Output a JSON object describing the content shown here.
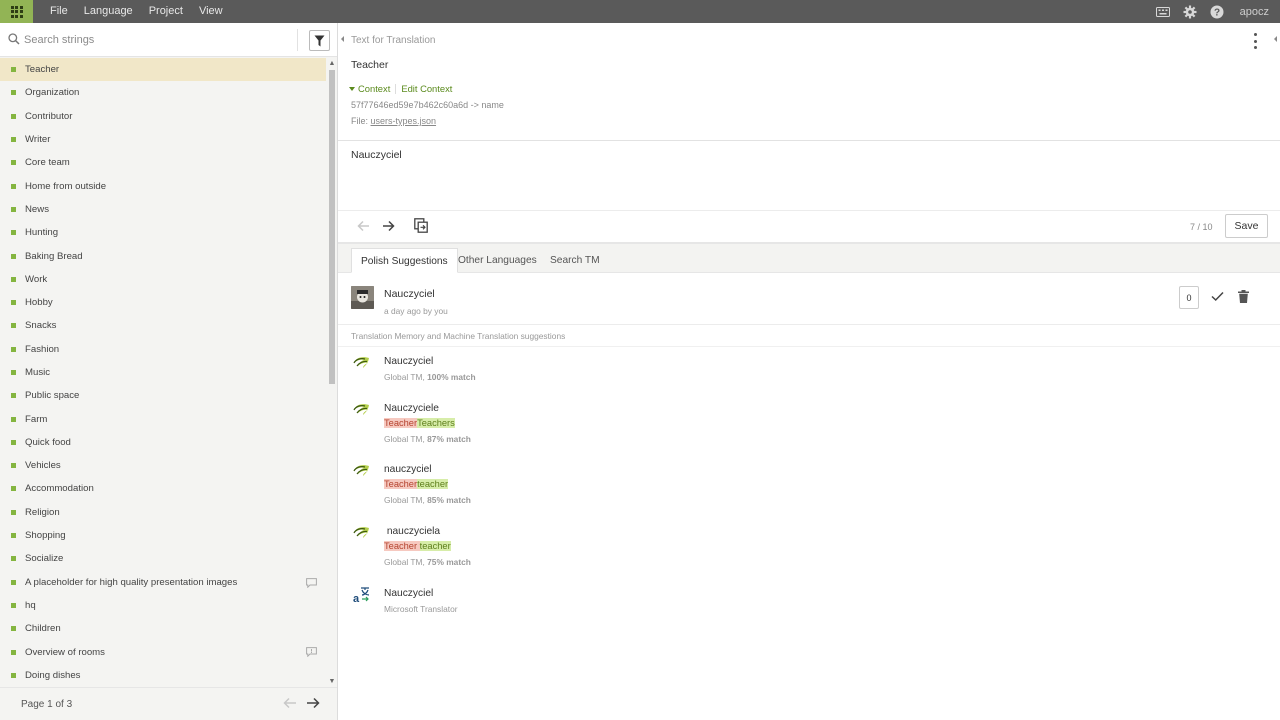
{
  "menubar": {
    "items": [
      "File",
      "Language",
      "Project",
      "View"
    ],
    "username": "apocz",
    "icons": [
      "keyboard-icon",
      "gear-icon",
      "help-icon"
    ]
  },
  "search": {
    "placeholder": "Search strings"
  },
  "strings": [
    {
      "label": "Teacher",
      "selected": true
    },
    {
      "label": "Organization"
    },
    {
      "label": "Contributor"
    },
    {
      "label": "Writer"
    },
    {
      "label": "Core team"
    },
    {
      "label": "Home from outside"
    },
    {
      "label": "News"
    },
    {
      "label": "Hunting"
    },
    {
      "label": "Baking Bread"
    },
    {
      "label": "Work"
    },
    {
      "label": "Hobby"
    },
    {
      "label": "Snacks"
    },
    {
      "label": "Fashion"
    },
    {
      "label": "Music"
    },
    {
      "label": "Public space"
    },
    {
      "label": "Farm"
    },
    {
      "label": "Quick food"
    },
    {
      "label": "Vehicles"
    },
    {
      "label": "Accommodation"
    },
    {
      "label": "Religion"
    },
    {
      "label": "Shopping"
    },
    {
      "label": "Socialize"
    },
    {
      "label": "A placeholder for high quality presentation images",
      "icon": "comment-icon"
    },
    {
      "label": "hq"
    },
    {
      "label": "Children"
    },
    {
      "label": "Overview of rooms",
      "icon": "comment-alert-icon"
    },
    {
      "label": "Doing dishes"
    }
  ],
  "pagination": {
    "label": "Page 1 of 3"
  },
  "editor": {
    "section_label": "Text for Translation",
    "source_text": "Teacher",
    "context_label": "Context",
    "edit_context_label": "Edit Context",
    "context_key": "57f77646ed59e7b462c60a6d -> name",
    "file_prefix": "File: ",
    "file_name": "users-types.json",
    "translation": "Nauczyciel",
    "counter": "7 / 10",
    "save_label": "Save"
  },
  "tabs": [
    {
      "label": "Polish Suggestions",
      "active": true
    },
    {
      "label": "Other Languages"
    },
    {
      "label": "Search TM"
    }
  ],
  "my_suggestion": {
    "text": "Nauczyciel",
    "meta": "a day ago by you",
    "votes": "0"
  },
  "tm_heading": "Translation Memory and Machine Translation suggestions",
  "tm_suggestions": [
    {
      "text": "Nauczyciel",
      "diff": null,
      "source": "Global TM, ",
      "match": "100% match",
      "icon": "crowdin-tm-icon"
    },
    {
      "text": "Nauczyciele",
      "diff": [
        {
          "t": "Teacher",
          "k": "del"
        },
        {
          "t": "Teachers",
          "k": "ins"
        }
      ],
      "source": "Global TM, ",
      "match": "87% match",
      "icon": "crowdin-tm-icon"
    },
    {
      "text": "nauczyciel",
      "diff": [
        {
          "t": "Teacher",
          "k": "del"
        },
        {
          "t": "teacher",
          "k": "ins"
        }
      ],
      "source": "Global TM, ",
      "match": "85% match",
      "icon": "crowdin-tm-icon"
    },
    {
      "text": " nauczyciela",
      "diff": [
        {
          "t": "Teacher ",
          "k": "del"
        },
        {
          "t": "teacher",
          "k": "ins"
        }
      ],
      "source": "Global TM, ",
      "match": "75% match",
      "icon": "crowdin-tm-icon"
    },
    {
      "text": "Nauczyciel",
      "diff": null,
      "source": "Microsoft Translator",
      "match": "",
      "icon": "microsoft-translator-icon"
    }
  ],
  "colors": {
    "accent": "#84b540",
    "topbar": "#5a5a5a",
    "selected_row": "#f1e7c8",
    "diff_deleted": "#f6c9c0",
    "diff_inserted": "#d7eda9"
  }
}
